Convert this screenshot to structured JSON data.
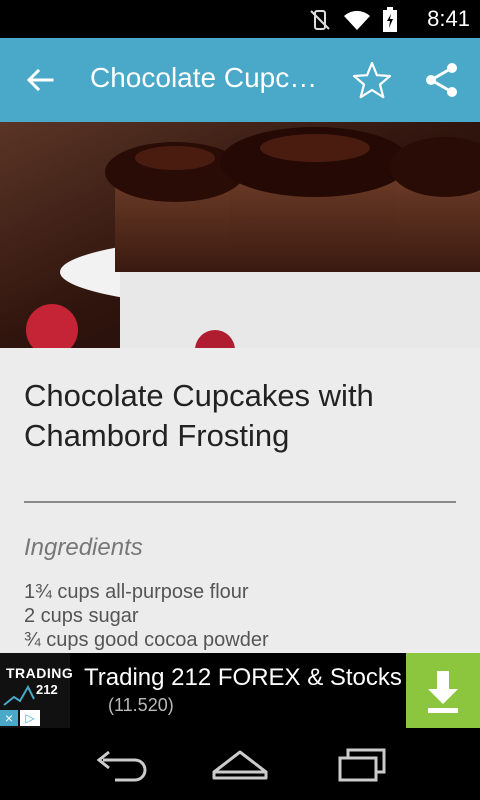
{
  "status_bar": {
    "time": "8:41",
    "icons": [
      "vibrate-icon",
      "wifi-icon",
      "battery-icon"
    ]
  },
  "app_bar": {
    "title": "Chocolate Cupc…",
    "back_icon": "arrow-back-icon",
    "favorite_icon": "star-outline-icon",
    "share_icon": "share-icon"
  },
  "recipe": {
    "title": "Chocolate Cupcakes with Chambord Frosting",
    "section_title": "Ingredients",
    "ingredients": [
      "1¾ cups all-purpose flour",
      "2 cups sugar",
      "¾ cups good cocoa powder"
    ]
  },
  "ad": {
    "logo_line1": "TRADING",
    "logo_line2": "212",
    "title": "Trading 212 FOREX & Stocks",
    "count": "(11.520)"
  },
  "nav_bar": {
    "icons": [
      "back-nav-icon",
      "home-nav-icon",
      "recent-apps-icon"
    ]
  },
  "colors": {
    "app_bar": "#4aa8c8",
    "ad_button": "#8cc63f"
  }
}
